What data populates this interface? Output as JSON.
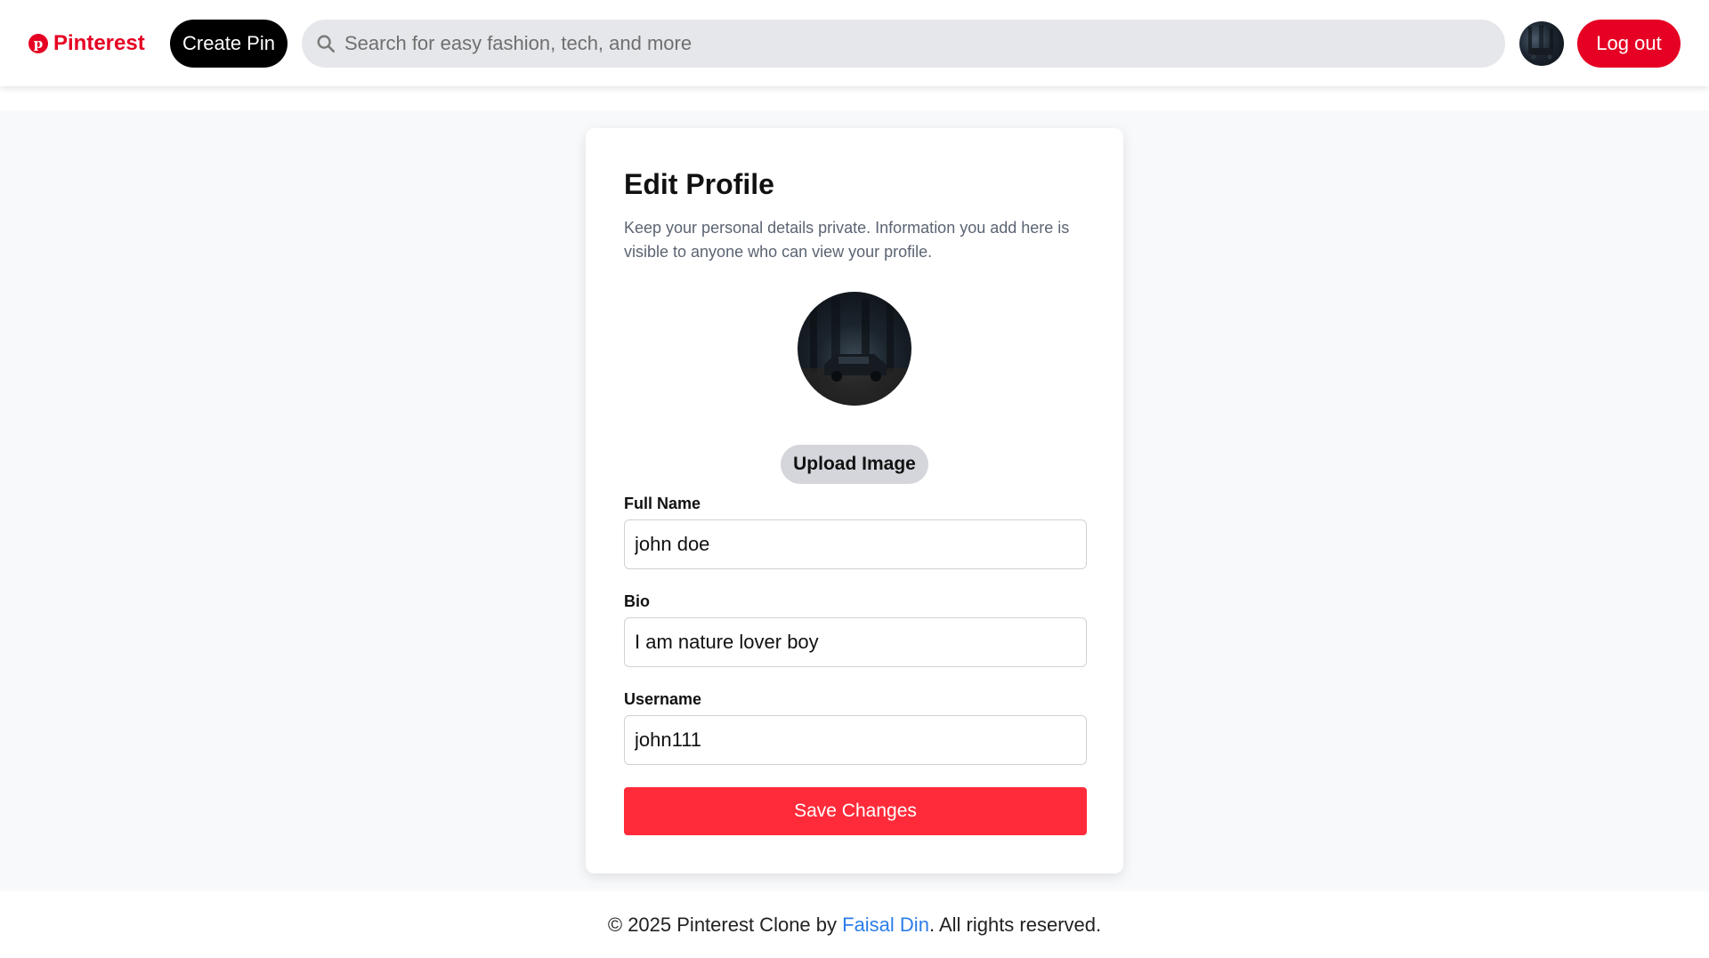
{
  "header": {
    "logo_text": "Pinterest",
    "logo_glyph": "p",
    "create_pin_label": "Create Pin",
    "search_placeholder": "Search for easy fashion, tech, and more",
    "logout_label": "Log out"
  },
  "colors": {
    "brand": "#e60023",
    "save_button": "#ff2b3a",
    "link": "#2b7de9"
  },
  "profile": {
    "title": "Edit Profile",
    "subtitle": "Keep your personal details private. Information you add here is visible to anyone who can view your profile.",
    "upload_label": "Upload Image",
    "fields": [
      {
        "label": "Full Name",
        "value": "john doe"
      },
      {
        "label": "Bio",
        "value": "I am nature lover boy"
      },
      {
        "label": "Username",
        "value": "john111"
      }
    ],
    "save_label": "Save Changes"
  },
  "footer": {
    "prefix": "© 2025 Pinterest Clone by ",
    "author": "Faisal Din",
    "suffix": ". All rights reserved."
  },
  "icons": {
    "search": "search-icon",
    "logo": "pinterest-logo-icon"
  }
}
